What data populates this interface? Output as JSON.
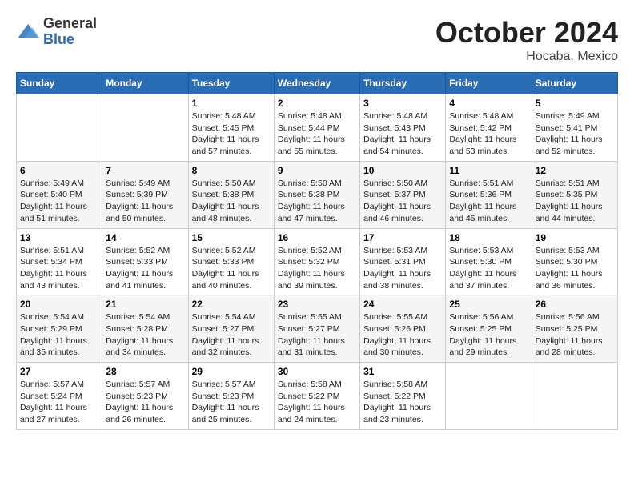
{
  "header": {
    "logo_general": "General",
    "logo_blue": "Blue",
    "month_title": "October 2024",
    "location": "Hocaba, Mexico"
  },
  "weekdays": [
    "Sunday",
    "Monday",
    "Tuesday",
    "Wednesday",
    "Thursday",
    "Friday",
    "Saturday"
  ],
  "weeks": [
    [
      {
        "day": "",
        "text": ""
      },
      {
        "day": "",
        "text": ""
      },
      {
        "day": "1",
        "text": "Sunrise: 5:48 AM\nSunset: 5:45 PM\nDaylight: 11 hours and 57 minutes."
      },
      {
        "day": "2",
        "text": "Sunrise: 5:48 AM\nSunset: 5:44 PM\nDaylight: 11 hours and 55 minutes."
      },
      {
        "day": "3",
        "text": "Sunrise: 5:48 AM\nSunset: 5:43 PM\nDaylight: 11 hours and 54 minutes."
      },
      {
        "day": "4",
        "text": "Sunrise: 5:48 AM\nSunset: 5:42 PM\nDaylight: 11 hours and 53 minutes."
      },
      {
        "day": "5",
        "text": "Sunrise: 5:49 AM\nSunset: 5:41 PM\nDaylight: 11 hours and 52 minutes."
      }
    ],
    [
      {
        "day": "6",
        "text": "Sunrise: 5:49 AM\nSunset: 5:40 PM\nDaylight: 11 hours and 51 minutes."
      },
      {
        "day": "7",
        "text": "Sunrise: 5:49 AM\nSunset: 5:39 PM\nDaylight: 11 hours and 50 minutes."
      },
      {
        "day": "8",
        "text": "Sunrise: 5:50 AM\nSunset: 5:38 PM\nDaylight: 11 hours and 48 minutes."
      },
      {
        "day": "9",
        "text": "Sunrise: 5:50 AM\nSunset: 5:38 PM\nDaylight: 11 hours and 47 minutes."
      },
      {
        "day": "10",
        "text": "Sunrise: 5:50 AM\nSunset: 5:37 PM\nDaylight: 11 hours and 46 minutes."
      },
      {
        "day": "11",
        "text": "Sunrise: 5:51 AM\nSunset: 5:36 PM\nDaylight: 11 hours and 45 minutes."
      },
      {
        "day": "12",
        "text": "Sunrise: 5:51 AM\nSunset: 5:35 PM\nDaylight: 11 hours and 44 minutes."
      }
    ],
    [
      {
        "day": "13",
        "text": "Sunrise: 5:51 AM\nSunset: 5:34 PM\nDaylight: 11 hours and 43 minutes."
      },
      {
        "day": "14",
        "text": "Sunrise: 5:52 AM\nSunset: 5:33 PM\nDaylight: 11 hours and 41 minutes."
      },
      {
        "day": "15",
        "text": "Sunrise: 5:52 AM\nSunset: 5:33 PM\nDaylight: 11 hours and 40 minutes."
      },
      {
        "day": "16",
        "text": "Sunrise: 5:52 AM\nSunset: 5:32 PM\nDaylight: 11 hours and 39 minutes."
      },
      {
        "day": "17",
        "text": "Sunrise: 5:53 AM\nSunset: 5:31 PM\nDaylight: 11 hours and 38 minutes."
      },
      {
        "day": "18",
        "text": "Sunrise: 5:53 AM\nSunset: 5:30 PM\nDaylight: 11 hours and 37 minutes."
      },
      {
        "day": "19",
        "text": "Sunrise: 5:53 AM\nSunset: 5:30 PM\nDaylight: 11 hours and 36 minutes."
      }
    ],
    [
      {
        "day": "20",
        "text": "Sunrise: 5:54 AM\nSunset: 5:29 PM\nDaylight: 11 hours and 35 minutes."
      },
      {
        "day": "21",
        "text": "Sunrise: 5:54 AM\nSunset: 5:28 PM\nDaylight: 11 hours and 34 minutes."
      },
      {
        "day": "22",
        "text": "Sunrise: 5:54 AM\nSunset: 5:27 PM\nDaylight: 11 hours and 32 minutes."
      },
      {
        "day": "23",
        "text": "Sunrise: 5:55 AM\nSunset: 5:27 PM\nDaylight: 11 hours and 31 minutes."
      },
      {
        "day": "24",
        "text": "Sunrise: 5:55 AM\nSunset: 5:26 PM\nDaylight: 11 hours and 30 minutes."
      },
      {
        "day": "25",
        "text": "Sunrise: 5:56 AM\nSunset: 5:25 PM\nDaylight: 11 hours and 29 minutes."
      },
      {
        "day": "26",
        "text": "Sunrise: 5:56 AM\nSunset: 5:25 PM\nDaylight: 11 hours and 28 minutes."
      }
    ],
    [
      {
        "day": "27",
        "text": "Sunrise: 5:57 AM\nSunset: 5:24 PM\nDaylight: 11 hours and 27 minutes."
      },
      {
        "day": "28",
        "text": "Sunrise: 5:57 AM\nSunset: 5:23 PM\nDaylight: 11 hours and 26 minutes."
      },
      {
        "day": "29",
        "text": "Sunrise: 5:57 AM\nSunset: 5:23 PM\nDaylight: 11 hours and 25 minutes."
      },
      {
        "day": "30",
        "text": "Sunrise: 5:58 AM\nSunset: 5:22 PM\nDaylight: 11 hours and 24 minutes."
      },
      {
        "day": "31",
        "text": "Sunrise: 5:58 AM\nSunset: 5:22 PM\nDaylight: 11 hours and 23 minutes."
      },
      {
        "day": "",
        "text": ""
      },
      {
        "day": "",
        "text": ""
      }
    ]
  ]
}
